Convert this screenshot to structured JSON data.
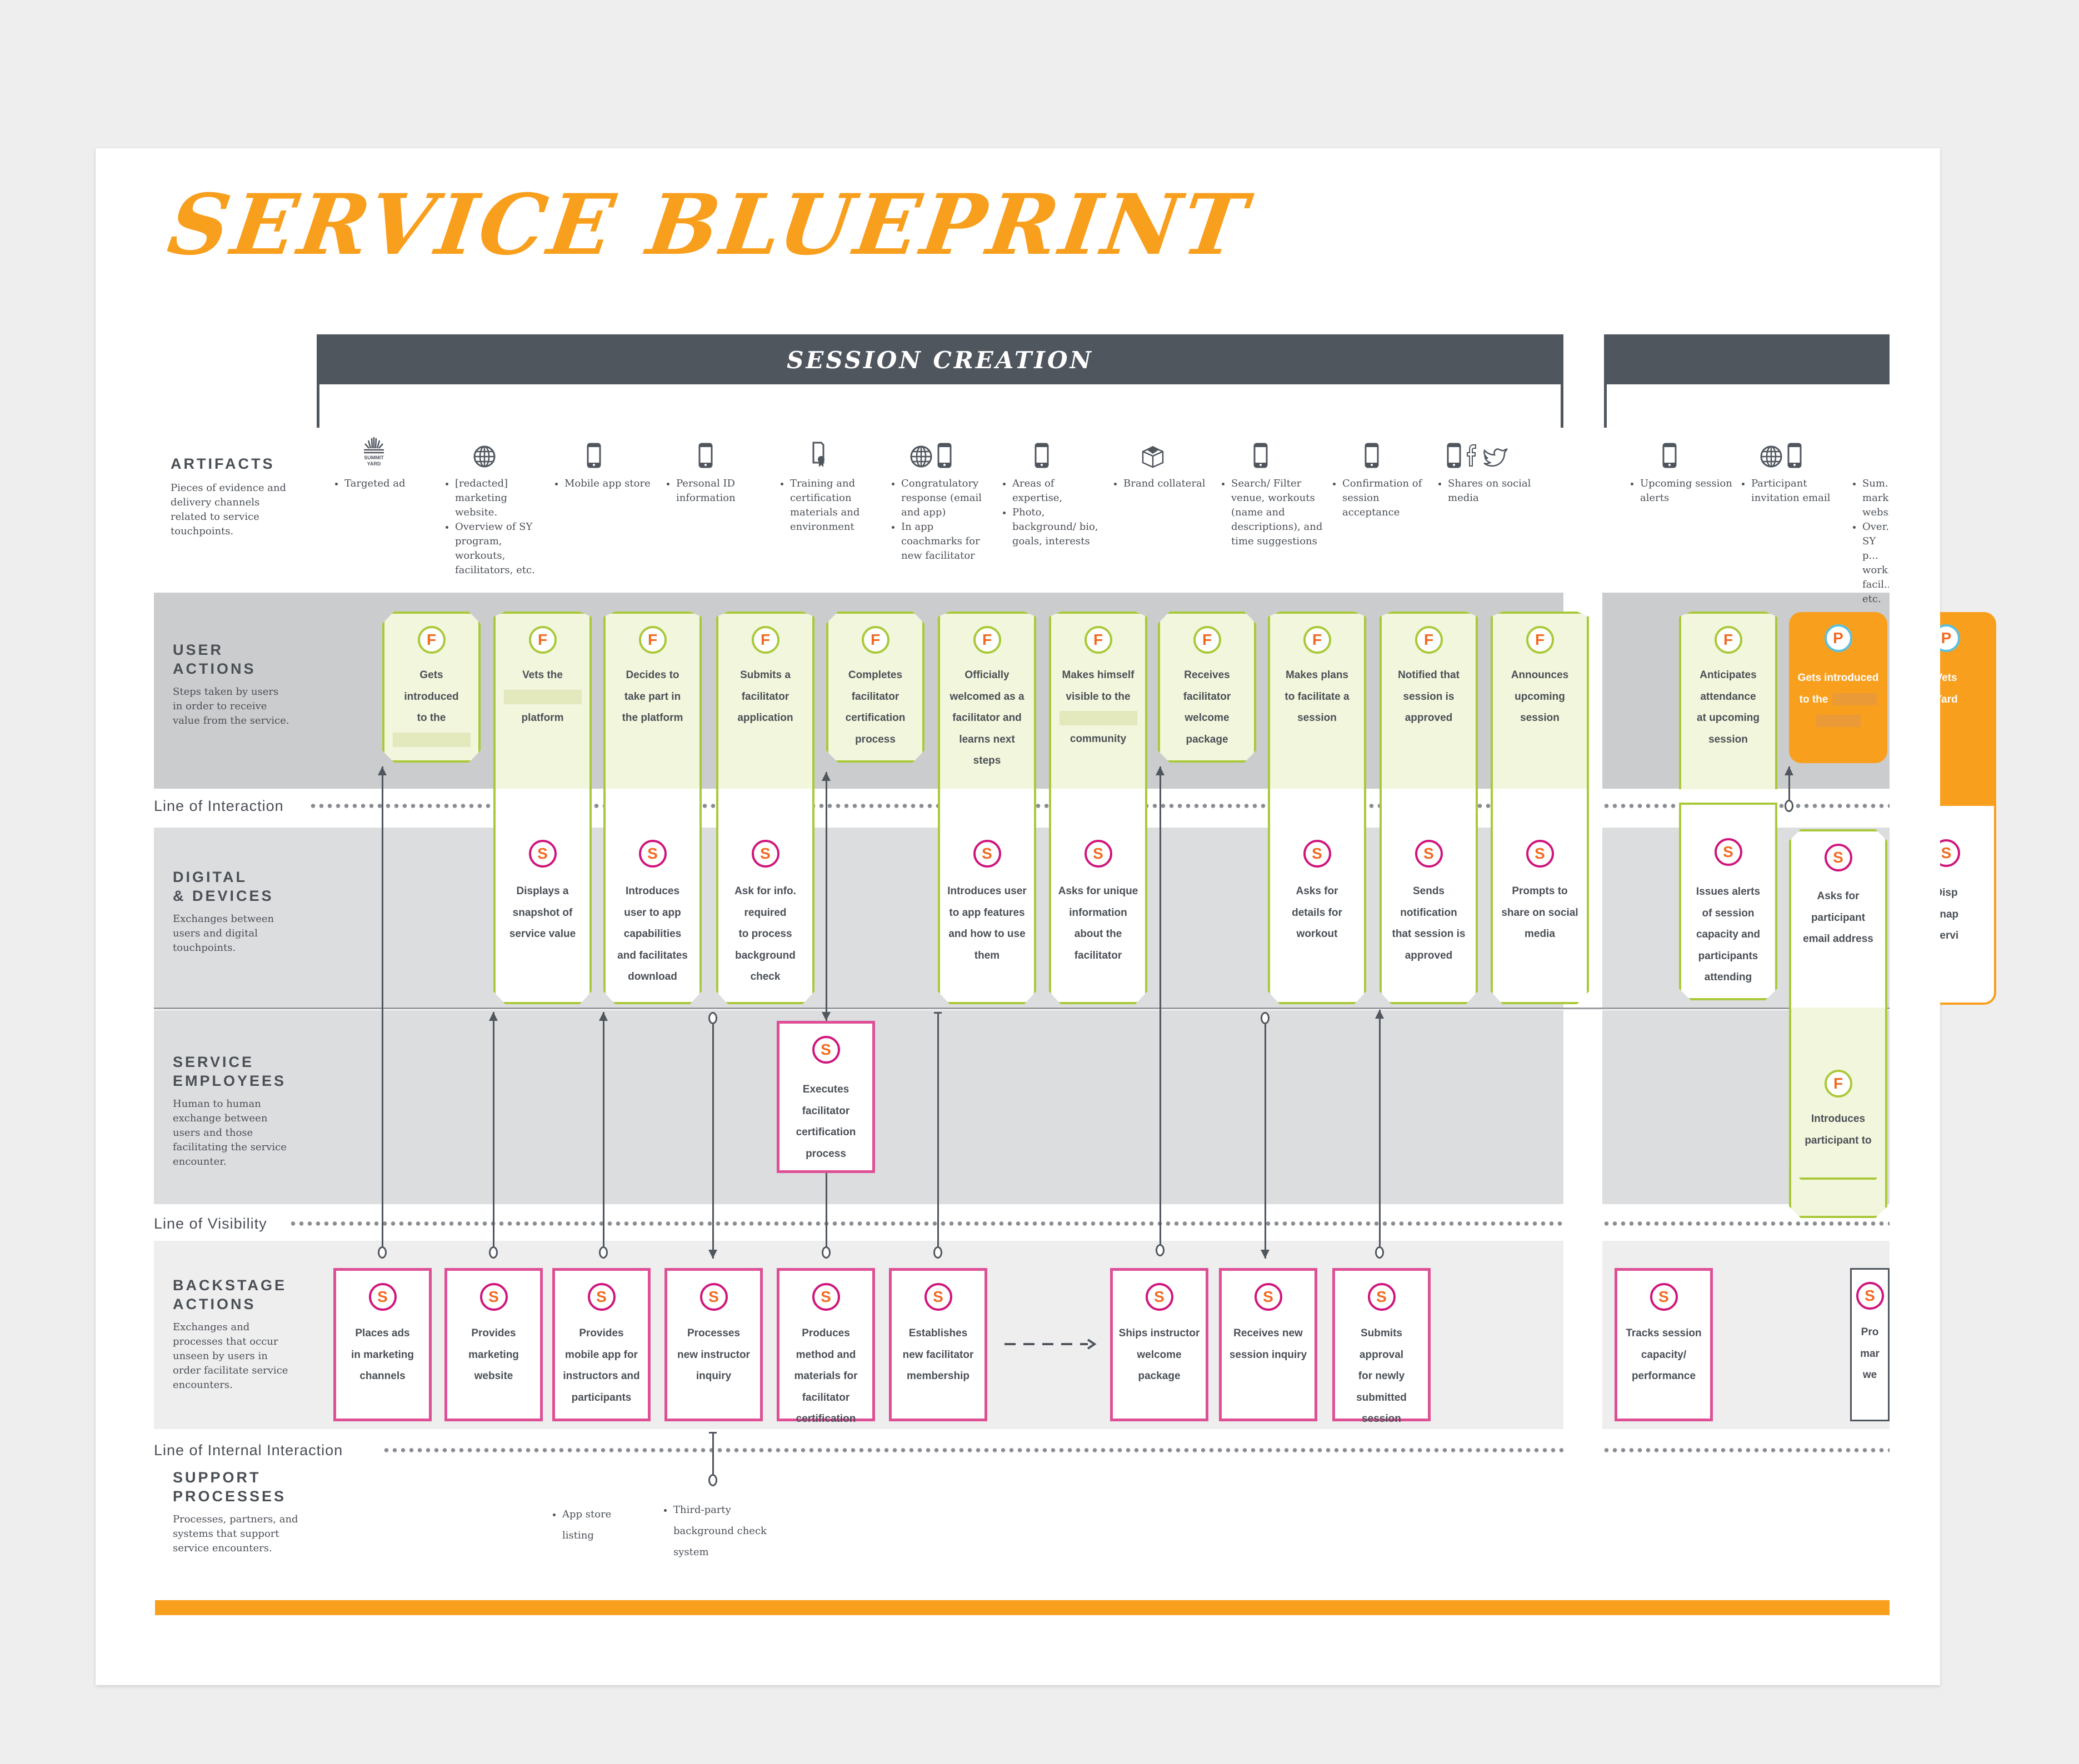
{
  "title": "SERVICE BLUEPRINT",
  "phases": [
    {
      "label": "SESSION CREATION"
    },
    {
      "label": ""
    }
  ],
  "rows": {
    "artifacts": {
      "label": "ARTIFACTS",
      "description": "Pieces of evidence and delivery channels related to service touchpoints."
    },
    "user_actions": {
      "label_line1": "USER",
      "label_line2": "ACTIONS",
      "description": "Steps taken by users  in order to receive value from the service."
    },
    "digital": {
      "label_line1": "DIGITAL",
      "label_line2": "& DEVICES",
      "description": "Exchanges between users and digital touchpoints."
    },
    "employees": {
      "label_line1": "SERVICE",
      "label_line2": "EMPLOYEES",
      "description": "Human to human exchange between users and those facilitating the service encounter."
    },
    "backstage": {
      "label_line1": "BACKSTAGE",
      "label_line2": "ACTIONS",
      "description": "Exchanges and processes that occur unseen by users in order facilitate service encounters."
    },
    "support": {
      "label_line1": "SUPPORT",
      "label_line2": "PROCESSES",
      "description": "Processes, partners, and systems that support service encounters."
    }
  },
  "lines": {
    "interaction": "Line of Interaction",
    "visibility": "Line of Visibility",
    "internal": "Line of Internal Interaction"
  },
  "artifacts": [
    {
      "icons": [
        "summit-yard-logo"
      ],
      "logo_text": "SUMMIT YARD",
      "items": [
        "Targeted ad"
      ]
    },
    {
      "icons": [
        "globe-icon"
      ],
      "items": [
        "[redacted] marketing website.",
        "Overview of SY program, workouts, facilitators, etc."
      ]
    },
    {
      "icons": [
        "phone-icon"
      ],
      "items": [
        "Mobile app store"
      ]
    },
    {
      "icons": [
        "phone-icon"
      ],
      "items": [
        "Personal ID information"
      ]
    },
    {
      "icons": [
        "certificate-icon"
      ],
      "items": [
        "Training and certification materials and environment"
      ]
    },
    {
      "icons": [
        "globe-icon",
        "phone-icon"
      ],
      "items": [
        "Congratulatory response (email and app)",
        "In app coachmarks for new facilitator"
      ]
    },
    {
      "icons": [
        "phone-icon"
      ],
      "items": [
        "Areas of expertise,",
        "Photo, background/ bio, goals, interests"
      ]
    },
    {
      "icons": [
        "box-icon"
      ],
      "items": [
        "Brand collateral"
      ]
    },
    {
      "icons": [
        "phone-icon"
      ],
      "items": [
        "Search/ Filter venue, workouts (name and descriptions), and time suggestions"
      ]
    },
    {
      "icons": [
        "phone-icon"
      ],
      "items": [
        "Confirmation of session acceptance"
      ]
    },
    {
      "icons": [
        "phone-icon",
        "facebook-icon",
        "twitter-icon"
      ],
      "items": [
        "Shares on social media"
      ]
    },
    {
      "icons": [
        "phone-icon"
      ],
      "items": [
        "Upcoming session alerts"
      ]
    },
    {
      "icons": [
        "globe-icon",
        "phone-icon"
      ],
      "items": [
        "Participant invitation email"
      ]
    },
    {
      "icons": [],
      "items": [
        "Sum... marketing website",
        "Over... SY p... work... facil... etc."
      ]
    }
  ],
  "user_actions": [
    {
      "badge": "F",
      "lines": [
        "Gets",
        "introduced",
        "to the"
      ],
      "redacted_after": true
    },
    {
      "badge": "F",
      "lines": [
        "Vets the"
      ],
      "redacted_mid": true,
      "lines_after": [
        "platform"
      ]
    },
    {
      "badge": "F",
      "lines": [
        "Decides to",
        "take part in",
        "the platform"
      ]
    },
    {
      "badge": "F",
      "lines": [
        "Submits a",
        "facilitator",
        "application"
      ]
    },
    {
      "badge": "F",
      "lines": [
        "Completes",
        "facilitator",
        "certification",
        "process"
      ]
    },
    {
      "badge": "F",
      "lines": [
        "Officially",
        "welcomed as a",
        "facilitator and",
        "learns next",
        "steps"
      ]
    },
    {
      "badge": "F",
      "lines": [
        "Makes himself",
        "visible to the"
      ],
      "redacted_mid": true,
      "lines_after": [
        "community"
      ]
    },
    {
      "badge": "F",
      "lines": [
        "Receives",
        "facilitator",
        "welcome",
        "package"
      ]
    },
    {
      "badge": "F",
      "lines": [
        "Makes plans",
        "to facilitate a",
        "session"
      ]
    },
    {
      "badge": "F",
      "lines": [
        "Notified that",
        "session is",
        "approved"
      ]
    },
    {
      "badge": "F",
      "lines": [
        "Announces",
        "upcoming",
        "session"
      ]
    },
    {
      "badge": "F",
      "lines": [
        "Anticipates",
        "attendance",
        "at upcoming",
        "session"
      ]
    },
    {
      "badge": "P",
      "lines": [
        "Gets introduced",
        "to the"
      ],
      "redacted_after": true
    },
    {
      "badge": "P",
      "lines": [
        "Vets",
        "Yard"
      ]
    }
  ],
  "digital": [
    {
      "badge": "S",
      "lines": [
        "Displays a",
        "snapshot of",
        "service value"
      ]
    },
    {
      "badge": "S",
      "lines": [
        "Introduces",
        "user to app",
        "capabilities",
        "and facilitates",
        "download"
      ]
    },
    {
      "badge": "S",
      "lines": [
        "Ask for info.",
        "required",
        "to process",
        "background",
        "check"
      ]
    },
    {
      "badge": "S",
      "lines": [
        "Introduces user",
        "to app features",
        "and how to use",
        "them"
      ]
    },
    {
      "badge": "S",
      "lines": [
        "Asks for unique",
        "information",
        "about the",
        "facilitator"
      ]
    },
    {
      "badge": "S",
      "lines": [
        "Asks for",
        "details  for",
        "workout"
      ]
    },
    {
      "badge": "S",
      "lines": [
        "Sends",
        "notification",
        "that session is",
        "approved"
      ]
    },
    {
      "badge": "S",
      "lines": [
        "Prompts to",
        "share on social",
        "media"
      ]
    },
    {
      "badge": "S",
      "lines": [
        "Issues alerts",
        "of session",
        "capacity and",
        "participants",
        "attending"
      ]
    },
    {
      "badge": "S",
      "lines": [
        "Asks for",
        "participant",
        "email address"
      ]
    },
    {
      "badge": "S",
      "lines": [
        "Disp",
        "snap",
        "servi"
      ]
    }
  ],
  "employees": [
    {
      "badge": "S",
      "lines": [
        "Executes",
        "facilitator",
        "certification",
        "process"
      ]
    },
    {
      "badge": "F",
      "lines": [
        "Introduces",
        "participant to"
      ]
    }
  ],
  "backstage": [
    {
      "badge": "S",
      "lines": [
        "Places ads",
        "in marketing",
        "channels"
      ]
    },
    {
      "badge": "S",
      "lines": [
        "Provides",
        "marketing",
        "website"
      ]
    },
    {
      "badge": "S",
      "lines": [
        "Provides",
        "mobile app for",
        "instructors and",
        "participants"
      ]
    },
    {
      "badge": "S",
      "lines": [
        "Processes",
        "new instructor",
        "inquiry"
      ]
    },
    {
      "badge": "S",
      "lines": [
        "Produces",
        "method and",
        "materials for",
        "facilitator",
        "certification"
      ]
    },
    {
      "badge": "S",
      "lines": [
        "Establishes",
        "new facilitator",
        "membership"
      ]
    },
    {
      "badge": "S",
      "lines": [
        "Ships instructor",
        "welcome",
        "package"
      ]
    },
    {
      "badge": "S",
      "lines": [
        "Receives new",
        "session inquiry"
      ]
    },
    {
      "badge": "S",
      "lines": [
        "Submits",
        "approval",
        "for newly",
        "submitted",
        "session"
      ]
    },
    {
      "badge": "S",
      "lines": [
        "Tracks session",
        "capacity/",
        "performance"
      ]
    },
    {
      "badge": "S",
      "lines": [
        "Pro",
        "mar",
        "we"
      ]
    }
  ],
  "support": [
    {
      "items": [
        "App store listing"
      ]
    },
    {
      "items": [
        "Third-party background check system"
      ]
    }
  ],
  "colors": {
    "accent_orange": "#f99f1e",
    "header_grey": "#50565e",
    "frontstage_green": "#a9c93a",
    "frontstage_fill": "#f2f6dc",
    "service_pink": "#de4f96",
    "badge_letter": "#f26a21",
    "participant_blue": "#5bc0de"
  }
}
